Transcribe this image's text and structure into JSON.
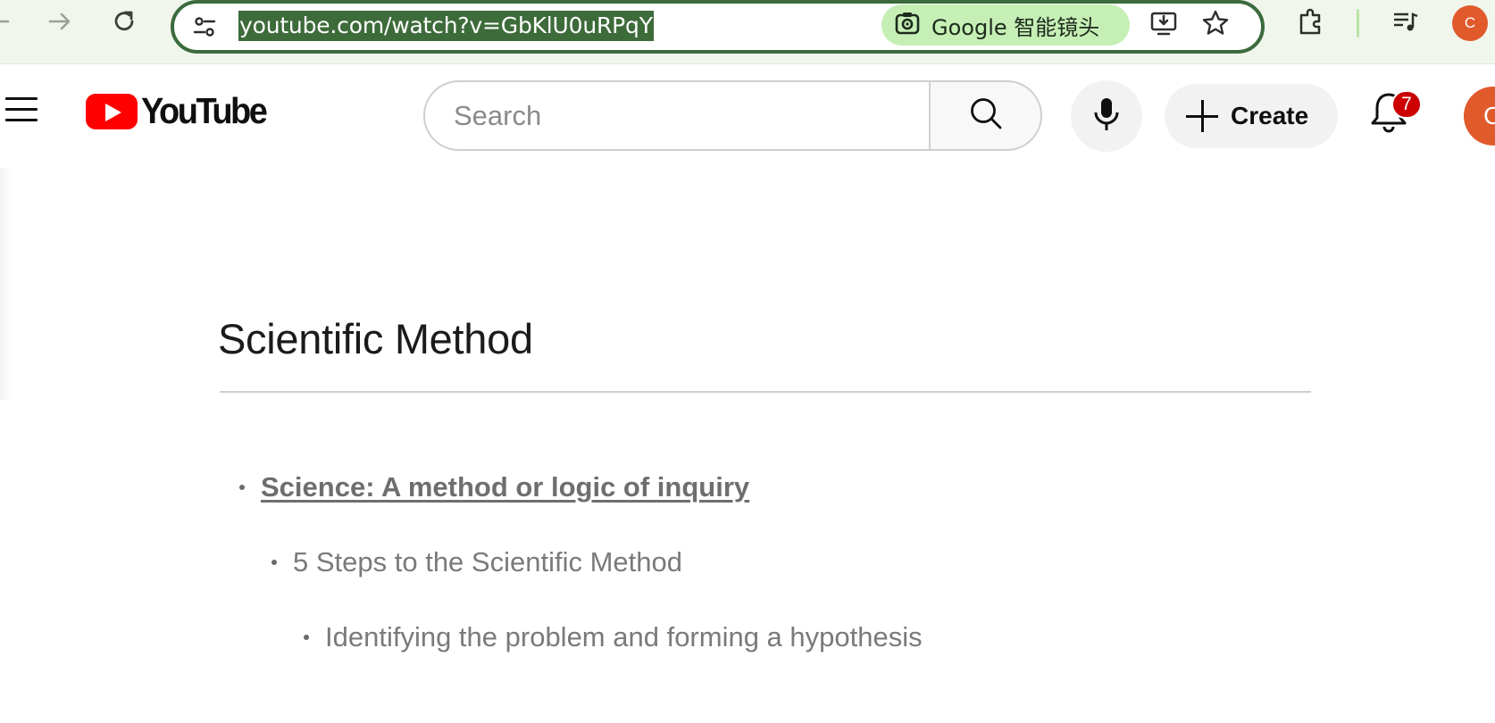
{
  "browser": {
    "url": "youtube.com/watch?v=GbKlU0uRPqY",
    "lens_label": "Google 智能镜头",
    "profile_initial": "C",
    "icons": [
      "back-icon",
      "forward-icon",
      "reload-icon",
      "site-settings-icon",
      "google-lens-icon",
      "install-app-icon",
      "bookmark-star-icon",
      "extensions-icon",
      "media-controls-icon"
    ]
  },
  "youtube": {
    "logo_text": "YouTube",
    "search_placeholder": "Search",
    "create_label": "Create",
    "notification_count": "7",
    "avatar_initial": "C"
  },
  "slide": {
    "title": "Scientific Method",
    "bullets": [
      {
        "level": 1,
        "text": "Science:  A method or logic of inquiry"
      },
      {
        "level": 2,
        "text": "5 Steps to the Scientific Method"
      },
      {
        "level": 3,
        "text": "Identifying the problem and forming a hypothesis"
      }
    ]
  },
  "colors": {
    "chrome_bg": "#f1f6ec",
    "url_highlight": "#3d6b3a",
    "lens_chip": "#c6efb6",
    "yt_red": "#ff0000",
    "badge_red": "#cc0000",
    "avatar": "#e05a2c"
  }
}
